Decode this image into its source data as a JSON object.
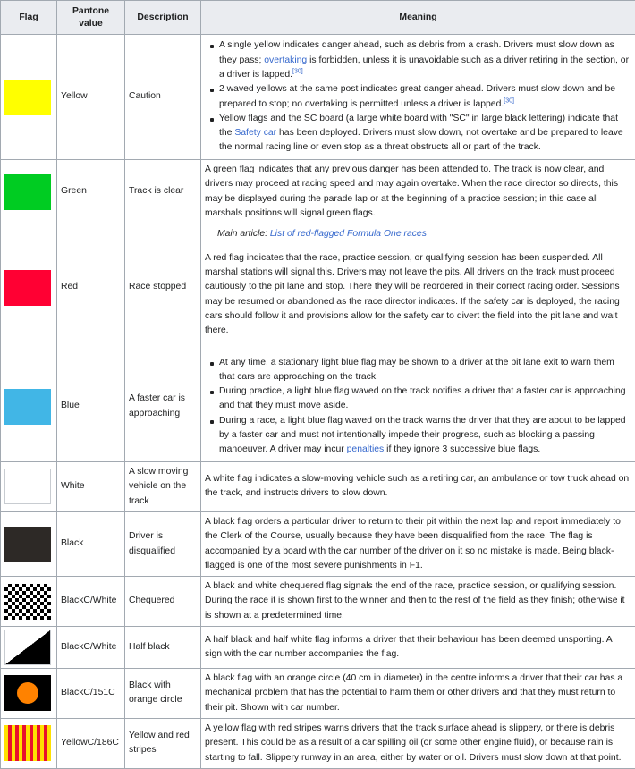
{
  "header": {
    "flag": "Flag",
    "pantone": "Pantone value",
    "description": "Description",
    "meaning": "Meaning"
  },
  "rows": [
    {
      "swatch_color": "#ffff00",
      "pantone": "Yellow",
      "description": "Caution",
      "bullets": [
        {
          "pre": "A single yellow indicates danger ahead, such as debris from a crash. Drivers must slow down as they pass; ",
          "link": "overtaking",
          "mid": " is forbidden, unless it is unavoidable such as a driver retiring in the section, or a driver is lapped.",
          "ref": "[30]"
        },
        {
          "pre": "2 waved yellows at the same post indicates great danger ahead. Drivers must slow down and be prepared to stop; no overtaking is permitted unless a driver is lapped.",
          "ref": "[30]"
        },
        {
          "pre": "Yellow flags and the SC board (a large white board with \"SC\" in large black lettering) indicate that the ",
          "link": "Safety car",
          "post": " has been deployed. Drivers must slow down, not overtake and be prepared to leave the normal racing line or even stop as a threat obstructs all or part of the track."
        }
      ]
    },
    {
      "swatch_color": "#00cc22",
      "pantone": "Green",
      "description": "Track is clear",
      "meaning": "A green flag indicates that any previous danger has been attended to. The track is now clear, and drivers may proceed at racing speed and may again overtake. When the race director so directs, this may be displayed during the parade lap or at the beginning of a practice session; in this case all marshals positions will signal green flags."
    },
    {
      "swatch_color": "#ff0033",
      "pantone": "Red",
      "description": "Race stopped",
      "hatnote_label": "Main article: ",
      "hatnote_link": "List of red-flagged Formula One races",
      "meaning": "A red flag indicates that the race, practice session, or qualifying session has been suspended. All marshal stations will signal this. Drivers may not leave the pits. All drivers on the track must proceed cautiously to the pit lane and stop. There they will be reordered in their correct racing order. Sessions may be resumed or abandoned as the race director indicates. If the safety car is deployed, the racing cars should follow it and provisions allow for the safety car to divert the field into the pit lane and wait there."
    },
    {
      "swatch_color": "#41b6e6",
      "pantone": "Blue",
      "description": "A faster car is approaching",
      "bullets": [
        {
          "pre": "At any time, a stationary light blue flag may be shown to a driver at the pit lane exit to warn them that cars are approaching on the track."
        },
        {
          "pre": "During practice, a light blue flag waved on the track notifies a driver that a faster car is approaching and that they must move aside."
        },
        {
          "pre": "During a race, a light blue flag waved on the track warns the driver that they are about to be lapped by a faster car and must not intentionally impede their progress, such as blocking a passing manoeuver. A driver may incur ",
          "link": "penalties",
          "post": " if they ignore 3 successive blue flags."
        }
      ]
    },
    {
      "swatch_color": "#ffffff",
      "pantone": "White",
      "description": "A slow moving vehicle on the track",
      "meaning": "A white flag indicates a slow-moving vehicle such as a retiring car, an ambulance or tow truck ahead on the track, and instructs drivers to slow down."
    },
    {
      "swatch_color": "#2d2926",
      "pantone": "Black",
      "description": "Driver is disqualified",
      "meaning": "A black flag orders a particular driver to return to their pit within the next lap and report immediately to the Clerk of the Course, usually because they have been disqualified from the race. The flag is accompanied by a board with the car number of the driver on it so no mistake is made. Being black-flagged is one of the most severe punishments in F1."
    },
    {
      "swatch_color": "#000000",
      "pantone": "BlackC/White",
      "description": "Chequered",
      "meaning": "A black and white chequered flag signals the end of the race, practice session, or qualifying session. During the race it is shown first to the winner and then to the rest of the field as they finish; otherwise it is shown at a predetermined time."
    },
    {
      "swatch_color": "#000000",
      "pantone": "BlackC/White",
      "description": "Half black",
      "meaning": "A half black and half white flag informs a driver that their behaviour has been deemed unsporting. A sign with the car number accompanies the flag."
    },
    {
      "swatch_color": "#000000",
      "circle_color": "#ff8200",
      "pantone": "BlackC/151C",
      "description": "Black with orange circle",
      "meaning": "A black flag with an orange circle (40 cm in diameter) in the centre informs a driver that their car has a mechanical problem that has the potential to harm them or other drivers and that they must return to their pit. Shown with car number."
    },
    {
      "swatch_color": "#ffe100",
      "stripe_color": "#e8112d",
      "pantone": "YellowC/186C",
      "description": "Yellow and red stripes",
      "meaning": "A yellow flag with red stripes warns drivers that the track surface ahead is slippery, or there is debris present. This could be as a result of a car spilling oil (or some other engine fluid), or because rain is starting to fall. Slippery runway in an area, either by water or oil. Drivers must slow down at that point."
    }
  ]
}
